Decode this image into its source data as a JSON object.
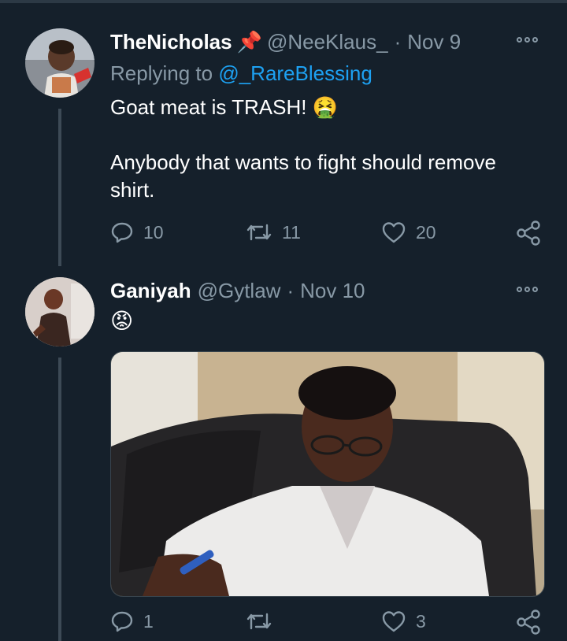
{
  "tweets": [
    {
      "display_name": "TheNicholas",
      "name_emoji": "📌",
      "handle": "@NeeKlaus_",
      "separator": "·",
      "date": "Nov 9",
      "replying_prefix": "Replying to",
      "replying_to": "@_RareBlessing",
      "text_line1": "Goat meat is TRASH!",
      "text_emoji": "🤮",
      "text_line2": "Anybody that wants to fight should remove",
      "text_line3": "shirt.",
      "reply_count": "10",
      "retweet_count": "11",
      "like_count": "20"
    },
    {
      "display_name": "Ganiyah",
      "handle": "@Gytlaw",
      "separator": "·",
      "date": "Nov 10",
      "text_emoji": "😡",
      "reply_count": "1",
      "retweet_count": "",
      "like_count": "3"
    }
  ],
  "icons": {
    "reply": "reply-icon",
    "retweet": "retweet-icon",
    "like": "heart-icon",
    "share": "share-icon",
    "more": "more-icon"
  },
  "colors": {
    "background": "#15202b",
    "muted": "#8899a6",
    "link": "#1da1f2"
  }
}
